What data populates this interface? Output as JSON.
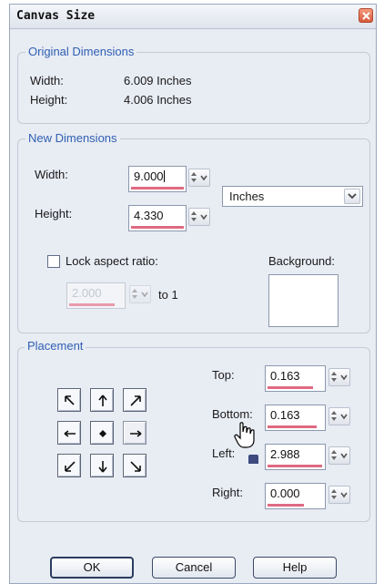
{
  "window": {
    "title": "Canvas Size"
  },
  "original": {
    "label": "Original Dimensions",
    "width_label": "Width:",
    "width_value": "6.009 Inches",
    "height_label": "Height:",
    "height_value": "4.006 Inches"
  },
  "new_dimensions": {
    "label": "New Dimensions",
    "width_label": "Width:",
    "width_value": "9.000",
    "height_label": "Height:",
    "height_value": "4.330",
    "units": "Inches",
    "lock_label": "Lock aspect ratio:",
    "lock_checked": false,
    "ratio_value": "2.000",
    "ratio_suffix": "to 1",
    "background_label": "Background:",
    "background_color": "#ffffff"
  },
  "placement": {
    "label": "Placement",
    "top_label": "Top:",
    "top_value": "0.163",
    "bottom_label": "Bottom:",
    "bottom_value": "0.163",
    "left_label": "Left:",
    "left_value": "2.988",
    "right_label": "Right:",
    "right_value": "0.000",
    "grid_icons": [
      "arrow-up-left-icon",
      "arrow-up-icon",
      "arrow-up-right-icon",
      "arrow-left-icon",
      "center-dot-icon",
      "arrow-right-icon",
      "arrow-down-left-icon",
      "arrow-down-icon",
      "arrow-down-right-icon"
    ]
  },
  "buttons": {
    "ok": "OK",
    "cancel": "Cancel",
    "help": "Help"
  },
  "colors": {
    "accent_label": "#2f5fb3",
    "field_indicator": "#df6a82",
    "dialog_bg": "#e8ecf3",
    "close_button": "#d85a3c"
  },
  "cursor": "hand-pointer-icon"
}
